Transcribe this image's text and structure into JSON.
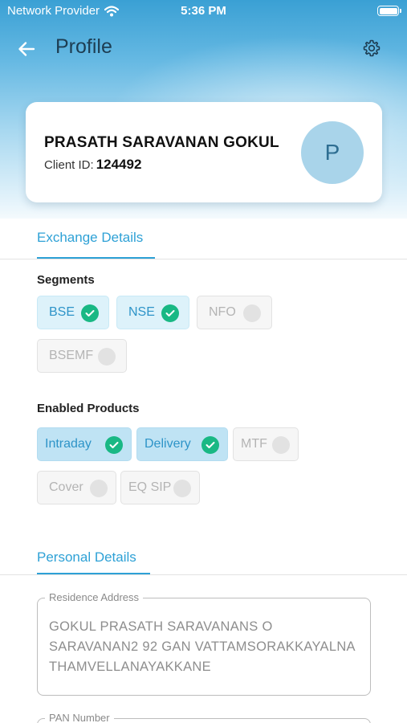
{
  "status_bar": {
    "carrier": "Network Provider",
    "time": "5:36 PM"
  },
  "header": {
    "title": "Profile"
  },
  "profile": {
    "name": "PRASATH SARAVANAN GOKUL",
    "client_id_label": "Client ID:",
    "client_id": "124492",
    "avatar_initial": "P"
  },
  "exchange_tab": "Exchange Details",
  "segments": {
    "heading": "Segments",
    "items": [
      {
        "label": "BSE",
        "enabled": true
      },
      {
        "label": "NSE",
        "enabled": true
      },
      {
        "label": "NFO",
        "enabled": false
      },
      {
        "label": "BSEMF",
        "enabled": false
      }
    ]
  },
  "products": {
    "heading": "Enabled Products",
    "items": [
      {
        "label": "Intraday",
        "enabled": true
      },
      {
        "label": "Delivery",
        "enabled": true
      },
      {
        "label": "MTF",
        "enabled": false
      },
      {
        "label": "Cover",
        "enabled": false
      },
      {
        "label": "EQ SIP",
        "enabled": false
      }
    ]
  },
  "personal_tab": "Personal Details",
  "fields": {
    "address_label": "Residence Address",
    "address_value": "GOKUL PRASATH SARAVANANS O SARAVANAN2 92 GAN VATTAMSORAKKAYALNA THAMVELLANAYAKKANE",
    "pan_label": "PAN Number"
  },
  "colors": {
    "accent": "#2ea1d6",
    "check": "#19b884",
    "title": "#1d3d52"
  },
  "icons": {
    "back": "arrow-left-icon",
    "settings": "gear-icon",
    "check": "check-icon",
    "wifi": "wifi-icon",
    "battery": "battery-icon"
  }
}
